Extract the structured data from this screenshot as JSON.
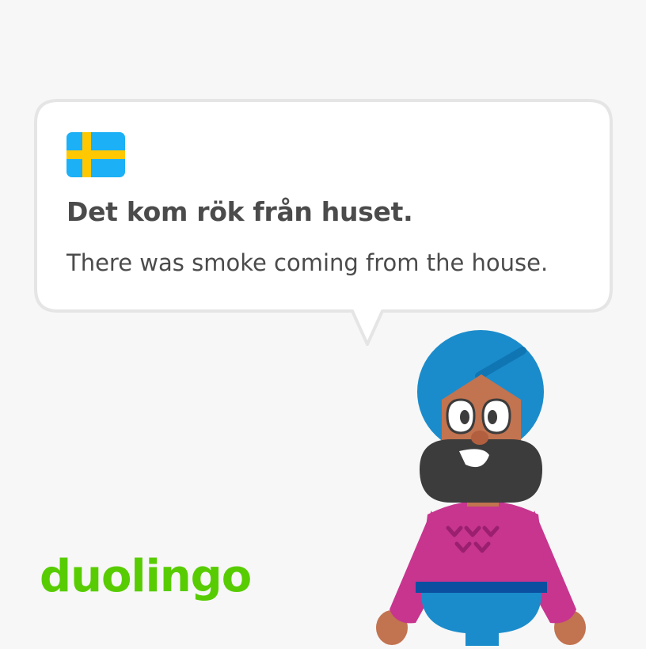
{
  "card": {
    "sentence": "Det kom rök från huset.",
    "translation": "There was smoke coming from the house."
  },
  "flag": {
    "icon": "sweden-flag-icon",
    "blue": "#1cb0f6",
    "yellow": "#ffc800"
  },
  "brand": {
    "logo_text": "duolingo",
    "color": "#58cc02"
  },
  "character": {
    "icon": "duolingo-character-turban-beard",
    "turban_color": "#1b8ccb",
    "sweater_color": "#c7358f",
    "beard_color": "#3c3c3c"
  },
  "colors": {
    "background": "#f7f7f7",
    "bubble_fill": "#ffffff",
    "bubble_border": "#e5e5e5",
    "text": "#4b4b4b"
  }
}
